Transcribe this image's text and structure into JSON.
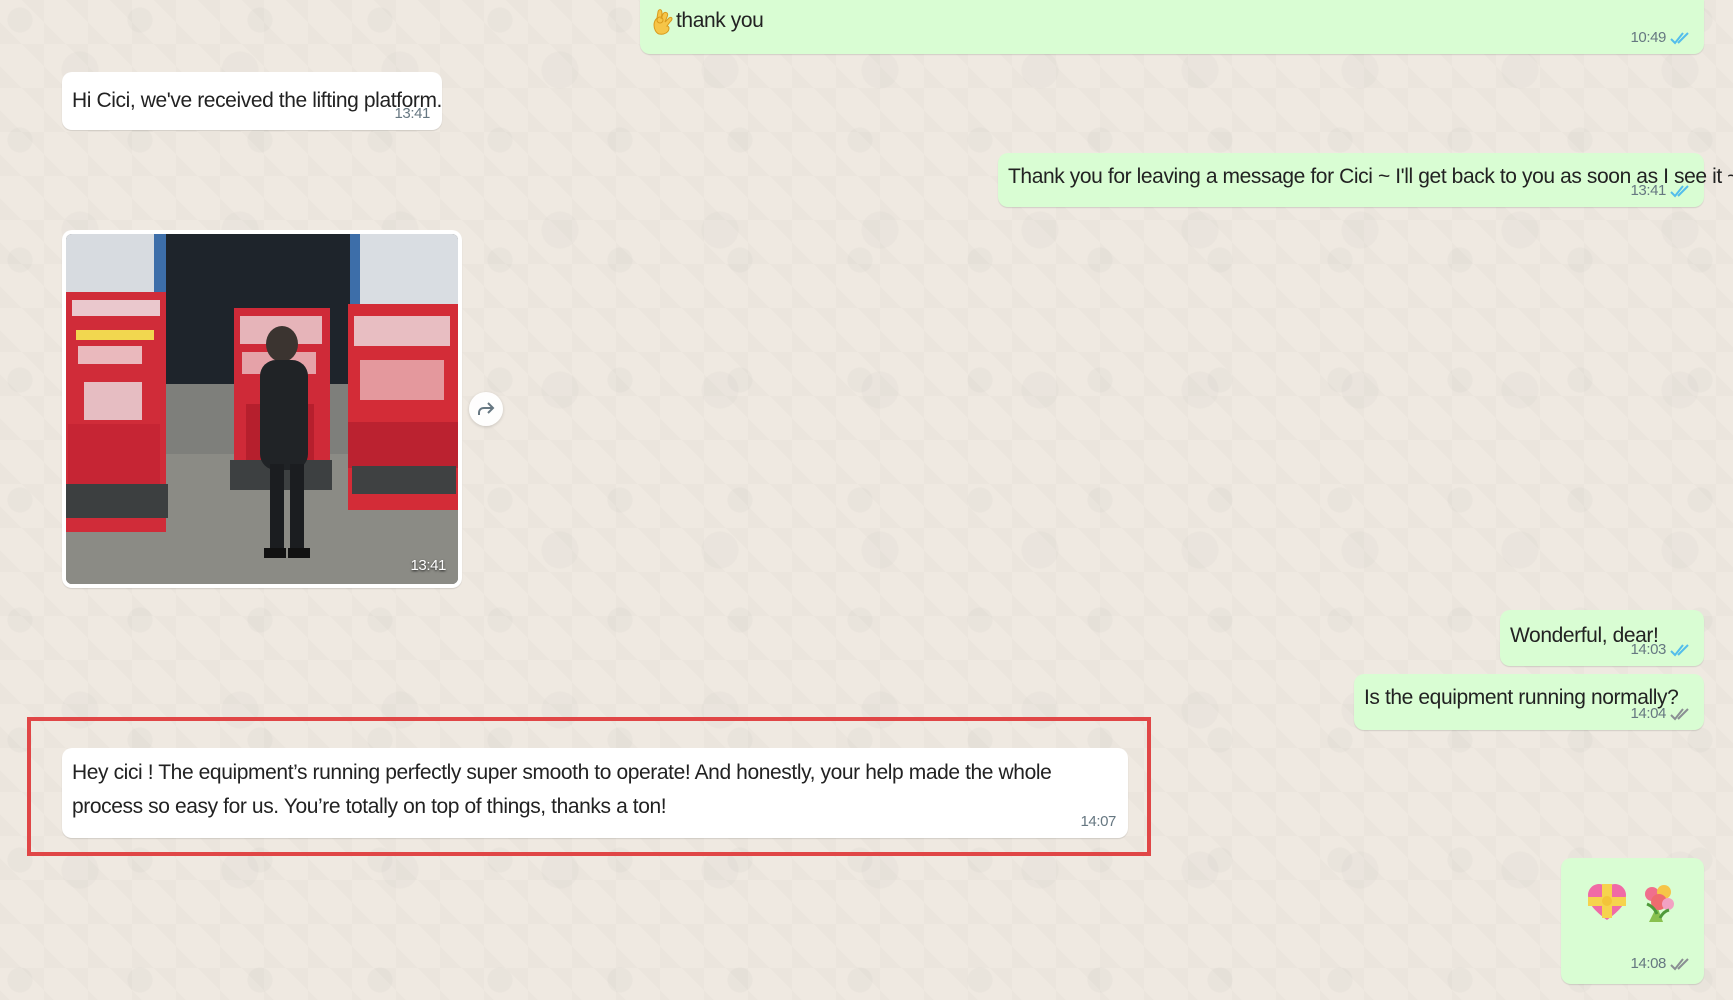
{
  "chat": {
    "messages": [
      {
        "direction": "outgoing",
        "text": "thank you",
        "time": "10:49",
        "status_icon": "double-check-icon",
        "leading_icon": "ok-hand-icon"
      },
      {
        "direction": "incoming",
        "text": "Hi Cici, we've received the lifting platform.",
        "time": "13:41"
      },
      {
        "direction": "outgoing",
        "text": "Thank you for leaving a message for Cici ~ I'll get back to you as soon as I see it ~",
        "time": "13:41",
        "status_icon": "double-check-icon"
      },
      {
        "direction": "incoming",
        "type": "image",
        "time": "13:41",
        "image_icon": "warehouse-photo"
      },
      {
        "direction": "outgoing",
        "text": "Wonderful, dear!",
        "time": "14:03",
        "status_icon": "double-check-icon"
      },
      {
        "direction": "outgoing",
        "text": "Is the equipment running normally?",
        "time": "14:04",
        "status_icon": "double-check-icon"
      },
      {
        "direction": "incoming",
        "text": "Hey cici ! The equipment’s running perfectly  super smooth to operate! And honestly, your help made the whole process so easy for us. You’re totally on top of things, thanks a ton!",
        "time": "14:07",
        "highlighted": true
      },
      {
        "direction": "outgoing",
        "type": "emoji",
        "emoji_icons": [
          "heart-with-ribbon-icon",
          "bouquet-icon"
        ],
        "time": "14:08",
        "status_icon": "double-check-icon"
      }
    ]
  },
  "icons": {
    "forward": "forward-icon"
  },
  "colors": {
    "incoming_bubble": "#ffffff",
    "outgoing_bubble": "#d9fdd3",
    "highlight_border": "#e04646",
    "read_check": "#53bdeb"
  }
}
